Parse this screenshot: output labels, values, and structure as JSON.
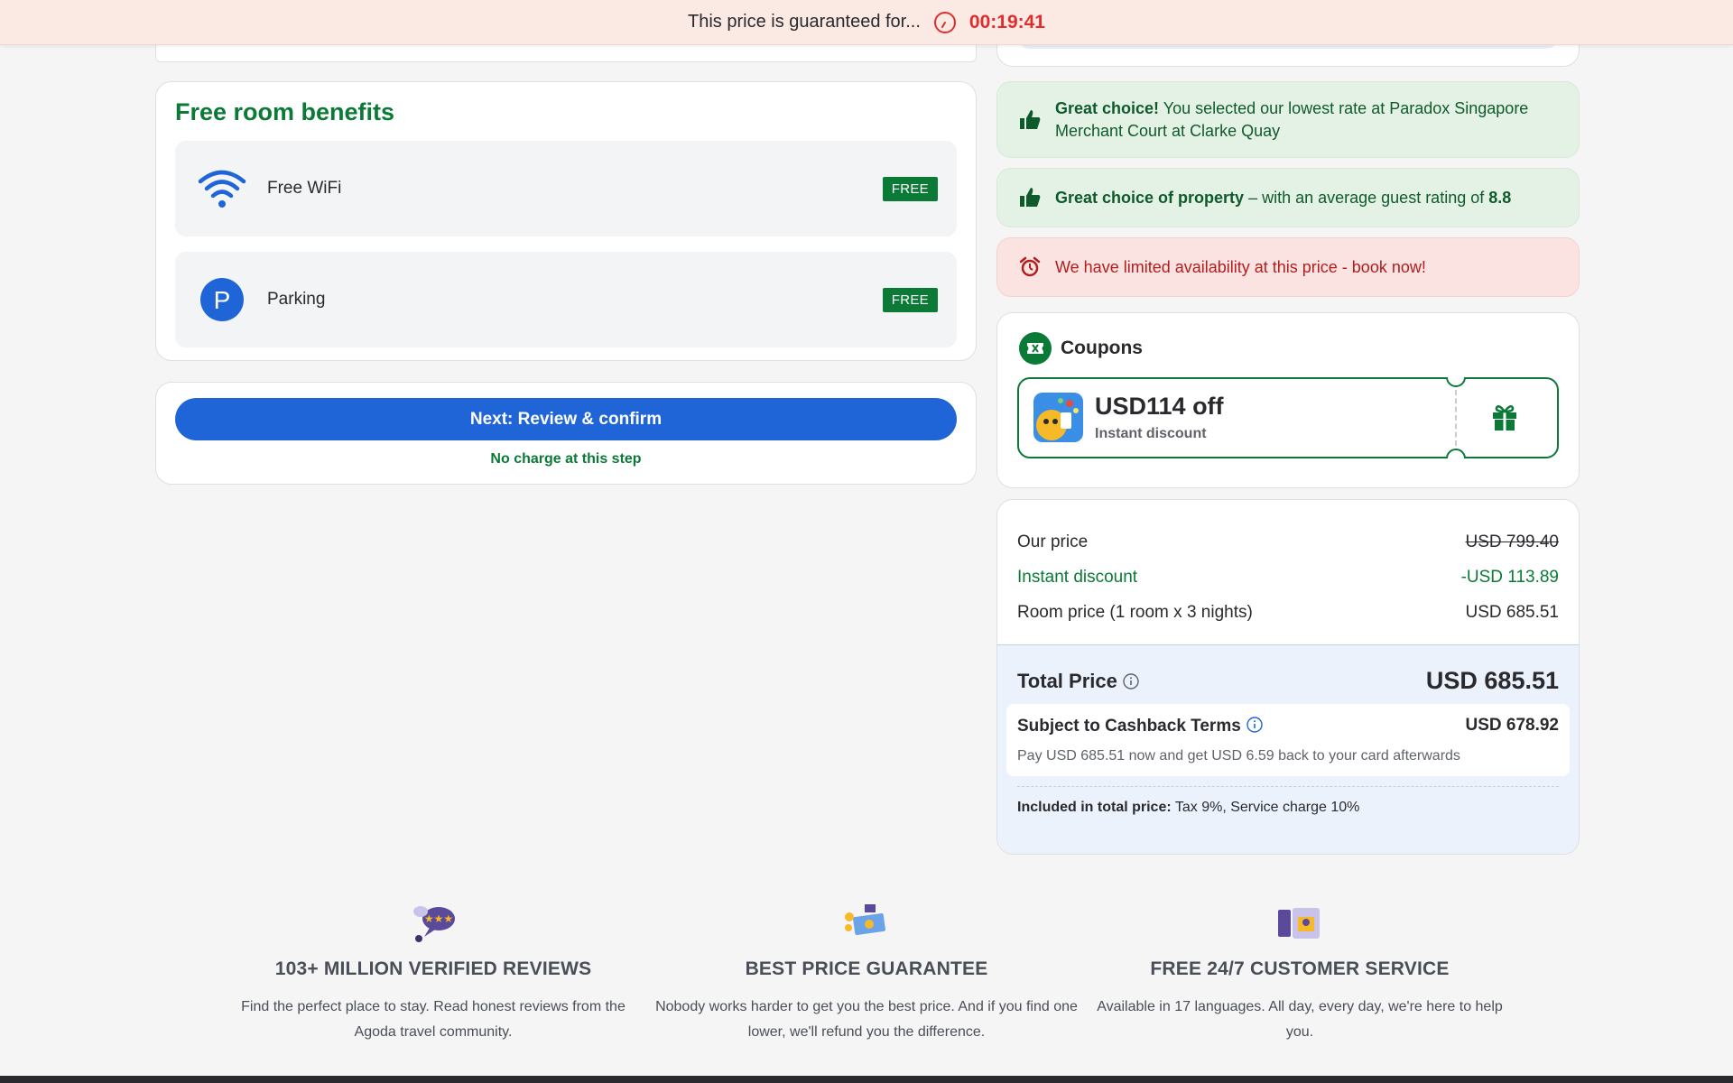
{
  "timer": {
    "text": "This price is guaranteed for...",
    "countdown": "00:19:41"
  },
  "benefits": {
    "title": "Free room benefits",
    "items": [
      {
        "label": "Free WiFi",
        "badge": "FREE",
        "icon": "wifi-icon"
      },
      {
        "label": "Parking",
        "badge": "FREE",
        "icon": "parking-icon"
      }
    ]
  },
  "next": {
    "button_label": "Next: Review & confirm",
    "note": "No charge at this step"
  },
  "messages": {
    "lowest_rate": {
      "strong": "Great choice!",
      "text": " You selected our lowest rate at Paradox Singapore Merchant Court at Clarke Quay"
    },
    "property": {
      "strong": "Great choice of property",
      "text": " – with an average guest rating of ",
      "rating": "8.8"
    },
    "availability": {
      "text": "We have limited availability at this price - book now!"
    }
  },
  "coupons": {
    "title": "Coupons",
    "amount": "USD114 off",
    "subtitle": "Instant discount"
  },
  "price": {
    "our_price_label": "Our price",
    "our_price_value": "USD 799.40",
    "discount_label": "Instant discount",
    "discount_value": "-USD 113.89",
    "room_label": "Room price (1 room x 3 nights)",
    "room_value": "USD 685.51",
    "total_label": "Total Price",
    "total_value": "USD 685.51",
    "cashback_label": "Subject to Cashback Terms",
    "cashback_value": "USD 678.92",
    "cashback_note": "Pay USD 685.51 now and get USD 6.59 back to your card afterwards",
    "included_label": "Included in total price:",
    "included_text": " Tax 9%, Service charge 10%"
  },
  "features": [
    {
      "title": "103+ MILLION VERIFIED REVIEWS",
      "text": "Find the perfect place to stay. Read honest reviews from the Agoda travel community."
    },
    {
      "title": "BEST PRICE GUARANTEE",
      "text": "Nobody works harder to get you the best price. And if you find one lower, we'll refund you the difference."
    },
    {
      "title": "FREE 24/7 CUSTOMER SERVICE",
      "text": "Available in 17 languages. All day, every day, we're here to help you."
    }
  ],
  "colors": {
    "brand_green": "#0b7a37",
    "primary_blue": "#1f65d8",
    "alert_red": "#e12d2d"
  }
}
